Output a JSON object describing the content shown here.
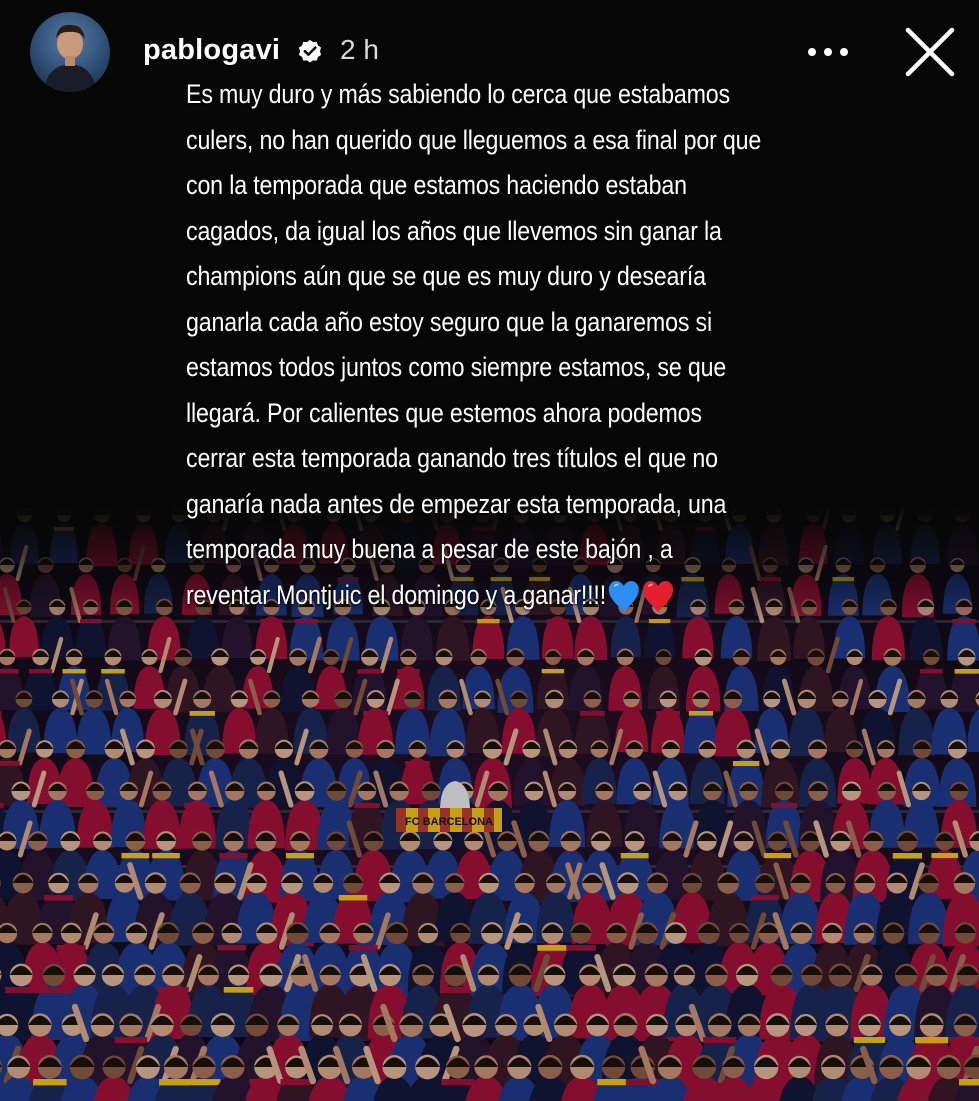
{
  "header": {
    "username": "pablogavi",
    "verified": true,
    "time": "2 h",
    "more_icon": "more-horizontal-icon",
    "close_icon": "close-icon"
  },
  "caption": {
    "lines": [
      "Es muy duro y más sabiendo lo cerca que estabamos",
      "culers, no han querido que lleguemos a esa final por que",
      "con la temporada que estamos haciendo estaban",
      "cagados, da igual los años que llevemos sin ganar la",
      "champions aún que se que es muy duro y desearía",
      "ganarla cada año estoy seguro que la ganaremos si",
      "estamos todos juntos como siempre estamos, se que",
      "llegará. Por calientes que estemos ahora podemos",
      "cerrar esta temporada ganando tres títulos el que no",
      "ganaría nada antes de empezar esta temporada, una",
      "temporada muy buena a pesar de este bajón , a",
      "reventar Montjuic el domingo y a ganar!!!!"
    ],
    "emojis": [
      "blue-heart-icon",
      "red-heart-icon"
    ]
  },
  "banner": {
    "text": "FC BARCELONA"
  },
  "colors": {
    "background": "#070707",
    "text": "#ffffff",
    "verified_badge": "#ffffff",
    "blaugrana_blue": "#1f3a8a",
    "blaugrana_red": "#a3123a"
  }
}
